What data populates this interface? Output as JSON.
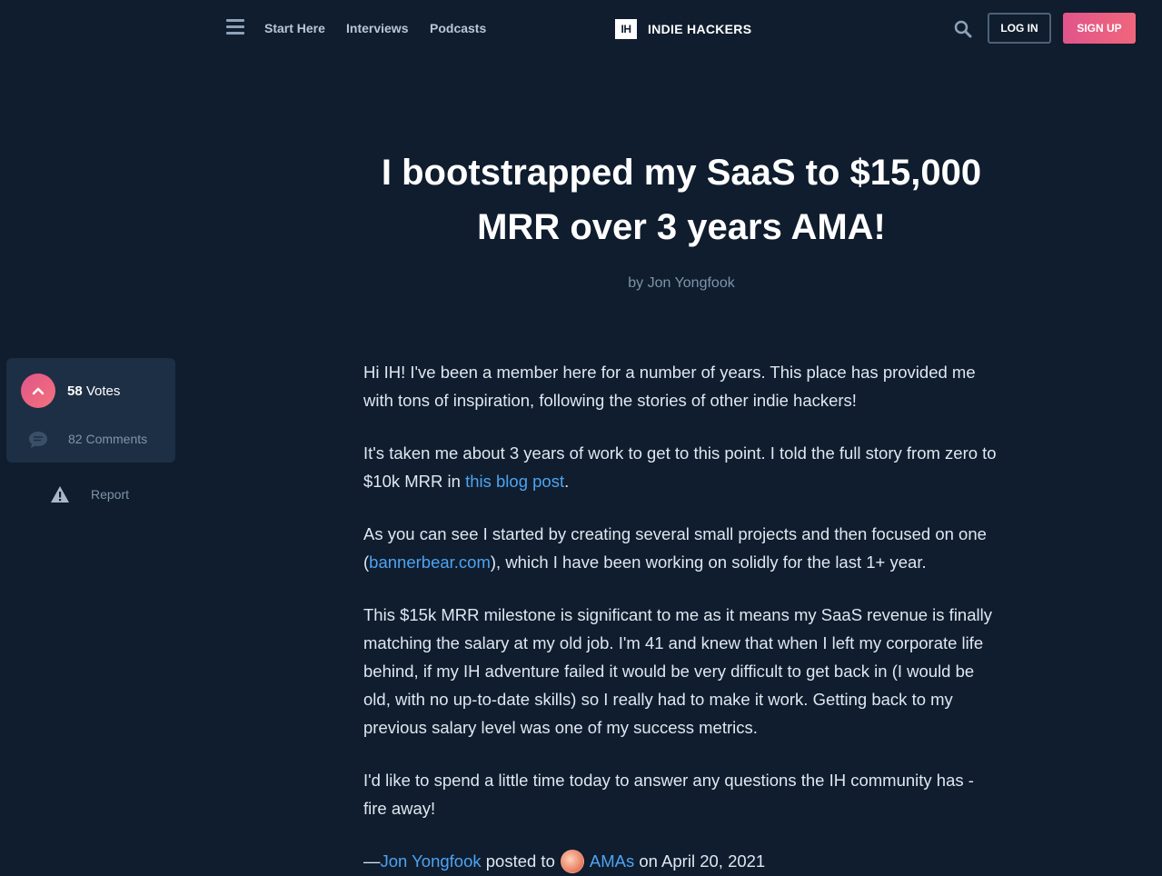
{
  "header": {
    "nav": [
      "Start Here",
      "Interviews",
      "Podcasts"
    ],
    "logo_mark": "IH",
    "logo_text": "INDIE HACKERS",
    "login": "LOG IN",
    "signup": "SIGN UP"
  },
  "post": {
    "title": "I bootstrapped my SaaS to $15,000 MRR over 3 years AMA!",
    "byline": "by Jon Yongfook",
    "p1": "Hi IH! I've been a member here for a number of years. This place has provided me with tons of inspiration, following the stories of other indie hackers!",
    "p2_before": "It's taken me about 3 years of work to get to this point. I told the full story from zero to $10k MRR in ",
    "p2_link": "this blog post",
    "p2_after": ".",
    "p3_before": "As you can see I started by creating several small projects and then focused on one (",
    "p3_link": "bannerbear.com",
    "p3_after": "), which I have been working on solidly for the last 1+ year.",
    "p4": "This $15k MRR milestone is significant to me as it means my SaaS revenue is finally matching the salary at my old job. I'm 41 and knew that when I left my corporate life behind, if my IH adventure failed it would be very difficult to get back in (I would be old, with no up-to-date skills) so I really had to make it work. Getting back to my previous salary level was one of my success metrics.",
    "p5": "I'd like to spend a little time today to answer any questions the IH community has - fire away!",
    "footer_dash": "—",
    "footer_author": "Jon Yongfook",
    "footer_posted_to": "posted to",
    "footer_group": "AMAs",
    "footer_date": "on April 20, 2021"
  },
  "sidebar": {
    "votes_count": "58",
    "votes_label": "Votes",
    "comments": "82 Comments",
    "report": "Report"
  },
  "colors": {
    "background": "#0f1d2e",
    "accent_pink": "#e0558a",
    "link_blue": "#4fa3f0"
  }
}
